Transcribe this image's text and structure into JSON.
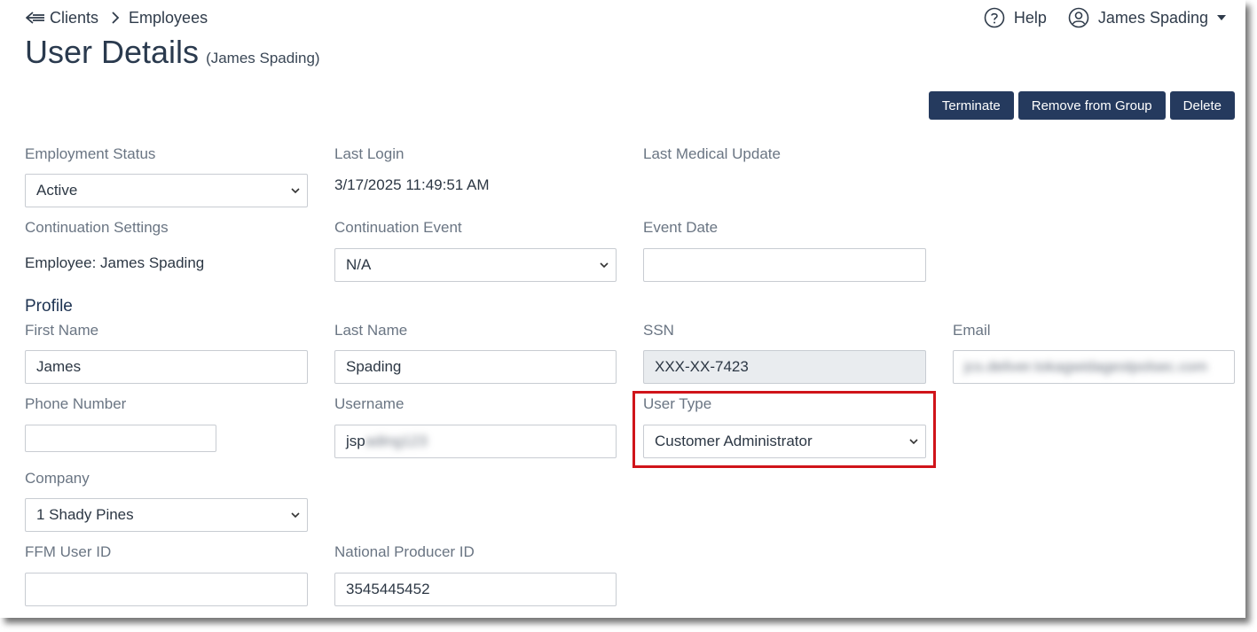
{
  "breadcrumb": {
    "clients": "Clients",
    "employees": "Employees"
  },
  "nav": {
    "help": "Help",
    "user": "James Spading"
  },
  "page": {
    "title": "User Details",
    "subtitle": "(James Spading)"
  },
  "actions": {
    "terminate": "Terminate",
    "remove": "Remove from Group",
    "delete": "Delete"
  },
  "status": {
    "employment_status_label": "Employment Status",
    "employment_status_value": "Active",
    "last_login_label": "Last Login",
    "last_login_value": "3/17/2025 11:49:51 AM",
    "last_medical_label": "Last Medical Update",
    "continuation_settings_label": "Continuation Settings",
    "continuation_settings_value": "Employee: James Spading",
    "continuation_event_label": "Continuation Event",
    "continuation_event_value": "N/A",
    "event_date_label": "Event Date",
    "event_date_value": ""
  },
  "profile": {
    "section_title": "Profile",
    "first_name_label": "First Name",
    "first_name_value": "James",
    "last_name_label": "Last Name",
    "last_name_value": "Spading",
    "ssn_label": "SSN",
    "ssn_value": "XXX-XX-7423",
    "email_label": "Email",
    "email_value": "jcs.deliver.tokagwidagestpolsec.com",
    "phone_label": "Phone Number",
    "phone_value": "",
    "username_label": "Username",
    "username_visible": "jsp",
    "username_blurred": "ading123",
    "user_type_label": "User Type",
    "user_type_value": "Customer Administrator",
    "company_label": "Company",
    "company_value": "1 Shady Pines",
    "ffm_label": "FFM User ID",
    "ffm_value": "",
    "npn_label": "National Producer ID",
    "npn_value": "3545445452"
  },
  "colors": {
    "button_bg": "#253a5e",
    "highlight": "#d0141a",
    "disabled_bg": "#e9ecef"
  }
}
